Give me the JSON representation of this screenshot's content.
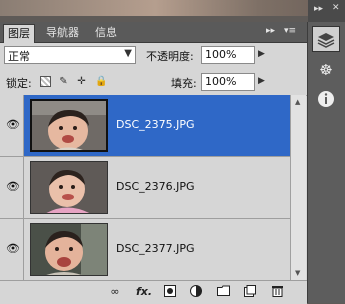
{
  "tabs": [
    {
      "label": "图层"
    },
    {
      "label": "导航器"
    },
    {
      "label": "信息"
    }
  ],
  "tab_controls": {
    "collapse": "▸▸",
    "menu": "▾≡"
  },
  "blend": {
    "mode": "正常",
    "arrow": "▼"
  },
  "opacity": {
    "label": "不透明度:",
    "value": "100%"
  },
  "lock": {
    "label": "锁定:"
  },
  "fill": {
    "label": "填充:",
    "value": "100%"
  },
  "layers": [
    {
      "name": "DSC_2375.JPG",
      "selected": true
    },
    {
      "name": "DSC_2376.JPG",
      "selected": false
    },
    {
      "name": "DSC_2377.JPG",
      "selected": false
    }
  ],
  "bottom_icons": [
    "link-icon",
    "fx-icon",
    "mask-icon",
    "adjustment-icon",
    "group-icon",
    "new-layer-icon",
    "trash-icon"
  ],
  "bottom_fx_label": "fx.",
  "side_icons": [
    "layers-icon",
    "navigator-icon",
    "info-icon"
  ],
  "side_controls": {
    "collapse": "▸▸",
    "close": "✕"
  },
  "colors": {
    "selection": "#2f68c7",
    "panel": "#d6d6d6",
    "tabbar": "#5a5a5a"
  }
}
